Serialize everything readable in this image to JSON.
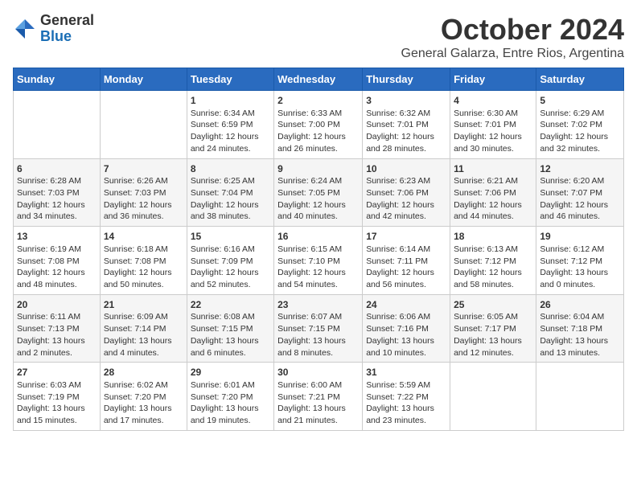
{
  "logo": {
    "general": "General",
    "blue": "Blue"
  },
  "header": {
    "month": "October 2024",
    "subtitle": "General Galarza, Entre Rios, Argentina"
  },
  "days_of_week": [
    "Sunday",
    "Monday",
    "Tuesday",
    "Wednesday",
    "Thursday",
    "Friday",
    "Saturday"
  ],
  "weeks": [
    [
      {
        "day": "",
        "info": ""
      },
      {
        "day": "",
        "info": ""
      },
      {
        "day": "1",
        "info": "Sunrise: 6:34 AM\nSunset: 6:59 PM\nDaylight: 12 hours\nand 24 minutes."
      },
      {
        "day": "2",
        "info": "Sunrise: 6:33 AM\nSunset: 7:00 PM\nDaylight: 12 hours\nand 26 minutes."
      },
      {
        "day": "3",
        "info": "Sunrise: 6:32 AM\nSunset: 7:01 PM\nDaylight: 12 hours\nand 28 minutes."
      },
      {
        "day": "4",
        "info": "Sunrise: 6:30 AM\nSunset: 7:01 PM\nDaylight: 12 hours\nand 30 minutes."
      },
      {
        "day": "5",
        "info": "Sunrise: 6:29 AM\nSunset: 7:02 PM\nDaylight: 12 hours\nand 32 minutes."
      }
    ],
    [
      {
        "day": "6",
        "info": "Sunrise: 6:28 AM\nSunset: 7:03 PM\nDaylight: 12 hours\nand 34 minutes."
      },
      {
        "day": "7",
        "info": "Sunrise: 6:26 AM\nSunset: 7:03 PM\nDaylight: 12 hours\nand 36 minutes."
      },
      {
        "day": "8",
        "info": "Sunrise: 6:25 AM\nSunset: 7:04 PM\nDaylight: 12 hours\nand 38 minutes."
      },
      {
        "day": "9",
        "info": "Sunrise: 6:24 AM\nSunset: 7:05 PM\nDaylight: 12 hours\nand 40 minutes."
      },
      {
        "day": "10",
        "info": "Sunrise: 6:23 AM\nSunset: 7:06 PM\nDaylight: 12 hours\nand 42 minutes."
      },
      {
        "day": "11",
        "info": "Sunrise: 6:21 AM\nSunset: 7:06 PM\nDaylight: 12 hours\nand 44 minutes."
      },
      {
        "day": "12",
        "info": "Sunrise: 6:20 AM\nSunset: 7:07 PM\nDaylight: 12 hours\nand 46 minutes."
      }
    ],
    [
      {
        "day": "13",
        "info": "Sunrise: 6:19 AM\nSunset: 7:08 PM\nDaylight: 12 hours\nand 48 minutes."
      },
      {
        "day": "14",
        "info": "Sunrise: 6:18 AM\nSunset: 7:08 PM\nDaylight: 12 hours\nand 50 minutes."
      },
      {
        "day": "15",
        "info": "Sunrise: 6:16 AM\nSunset: 7:09 PM\nDaylight: 12 hours\nand 52 minutes."
      },
      {
        "day": "16",
        "info": "Sunrise: 6:15 AM\nSunset: 7:10 PM\nDaylight: 12 hours\nand 54 minutes."
      },
      {
        "day": "17",
        "info": "Sunrise: 6:14 AM\nSunset: 7:11 PM\nDaylight: 12 hours\nand 56 minutes."
      },
      {
        "day": "18",
        "info": "Sunrise: 6:13 AM\nSunset: 7:12 PM\nDaylight: 12 hours\nand 58 minutes."
      },
      {
        "day": "19",
        "info": "Sunrise: 6:12 AM\nSunset: 7:12 PM\nDaylight: 13 hours\nand 0 minutes."
      }
    ],
    [
      {
        "day": "20",
        "info": "Sunrise: 6:11 AM\nSunset: 7:13 PM\nDaylight: 13 hours\nand 2 minutes."
      },
      {
        "day": "21",
        "info": "Sunrise: 6:09 AM\nSunset: 7:14 PM\nDaylight: 13 hours\nand 4 minutes."
      },
      {
        "day": "22",
        "info": "Sunrise: 6:08 AM\nSunset: 7:15 PM\nDaylight: 13 hours\nand 6 minutes."
      },
      {
        "day": "23",
        "info": "Sunrise: 6:07 AM\nSunset: 7:15 PM\nDaylight: 13 hours\nand 8 minutes."
      },
      {
        "day": "24",
        "info": "Sunrise: 6:06 AM\nSunset: 7:16 PM\nDaylight: 13 hours\nand 10 minutes."
      },
      {
        "day": "25",
        "info": "Sunrise: 6:05 AM\nSunset: 7:17 PM\nDaylight: 13 hours\nand 12 minutes."
      },
      {
        "day": "26",
        "info": "Sunrise: 6:04 AM\nSunset: 7:18 PM\nDaylight: 13 hours\nand 13 minutes."
      }
    ],
    [
      {
        "day": "27",
        "info": "Sunrise: 6:03 AM\nSunset: 7:19 PM\nDaylight: 13 hours\nand 15 minutes."
      },
      {
        "day": "28",
        "info": "Sunrise: 6:02 AM\nSunset: 7:20 PM\nDaylight: 13 hours\nand 17 minutes."
      },
      {
        "day": "29",
        "info": "Sunrise: 6:01 AM\nSunset: 7:20 PM\nDaylight: 13 hours\nand 19 minutes."
      },
      {
        "day": "30",
        "info": "Sunrise: 6:00 AM\nSunset: 7:21 PM\nDaylight: 13 hours\nand 21 minutes."
      },
      {
        "day": "31",
        "info": "Sunrise: 5:59 AM\nSunset: 7:22 PM\nDaylight: 13 hours\nand 23 minutes."
      },
      {
        "day": "",
        "info": ""
      },
      {
        "day": "",
        "info": ""
      }
    ]
  ]
}
